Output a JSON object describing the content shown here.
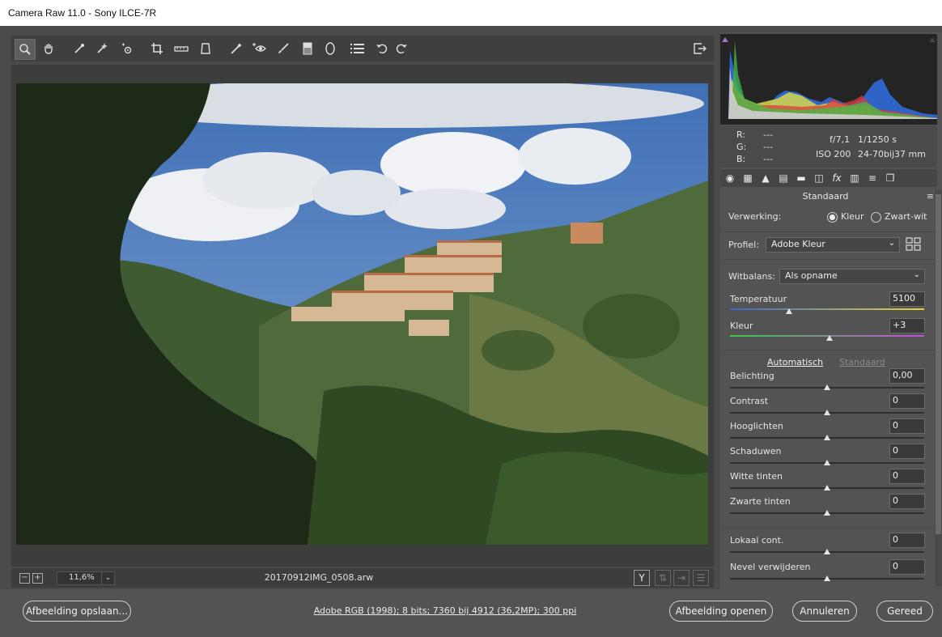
{
  "window": {
    "title": "Camera Raw 11.0  -  Sony ILCE-7R"
  },
  "toolbar": {
    "tools": [
      "zoom-tool",
      "hand-tool",
      "white-balance-tool",
      "color-sampler-tool",
      "targeted-adjustment-tool",
      "crop-tool",
      "straighten-tool",
      "transform-tool",
      "spot-removal-tool",
      "red-eye-tool",
      "adjustment-brush",
      "graduated-filter",
      "radial-filter",
      "presets-list",
      "rotate-left",
      "rotate-right"
    ],
    "active_tool": "zoom-tool"
  },
  "status": {
    "zoom": "11,6%",
    "filename": "20170912IMG_0508.arw",
    "before_after_label": "Y"
  },
  "info": {
    "r_label": "R:",
    "g_label": "G:",
    "b_label": "B:",
    "r_value": "---",
    "g_value": "---",
    "b_value": "---",
    "aperture": "f/7,1",
    "shutter": "1/1250 s",
    "iso": "ISO 200",
    "lens": "24-70bij37 mm"
  },
  "panel": {
    "title": "Standaard",
    "verwerking_label": "Verwerking:",
    "kleur_option": "Kleur",
    "zwartwit_option": "Zwart-wit",
    "profiel_label": "Profiel:",
    "profiel_value": "Adobe Kleur",
    "witbalans_label": "Witbalans:",
    "witbalans_value": "Als opname",
    "temperatuur_label": "Temperatuur",
    "temperatuur_value": "5100",
    "kleur_label": "Kleur",
    "kleur_value": "+3",
    "auto_link": "Automatisch",
    "standaard_link": "Standaard",
    "sliders": [
      {
        "label": "Belichting",
        "value": "0,00"
      },
      {
        "label": "Contrast",
        "value": "0"
      },
      {
        "label": "Hooglichten",
        "value": "0"
      },
      {
        "label": "Schaduwen",
        "value": "0"
      },
      {
        "label": "Witte tinten",
        "value": "0"
      },
      {
        "label": "Zwarte tinten",
        "value": "0"
      },
      {
        "label": "Lokaal cont.",
        "value": "0"
      },
      {
        "label": "Nevel verwijderen",
        "value": "0"
      }
    ]
  },
  "bottom": {
    "save_label": "Afbeelding opslaan...",
    "workflow_link": "Adobe RGB (1998); 8 bits; 7360 bij 4912 (36,2MP); 300 ppi",
    "open_label": "Afbeelding openen",
    "cancel_label": "Annuleren",
    "done_label": "Gereed"
  },
  "colors": {
    "background": "#535353",
    "histogram_bg": "#242424"
  }
}
